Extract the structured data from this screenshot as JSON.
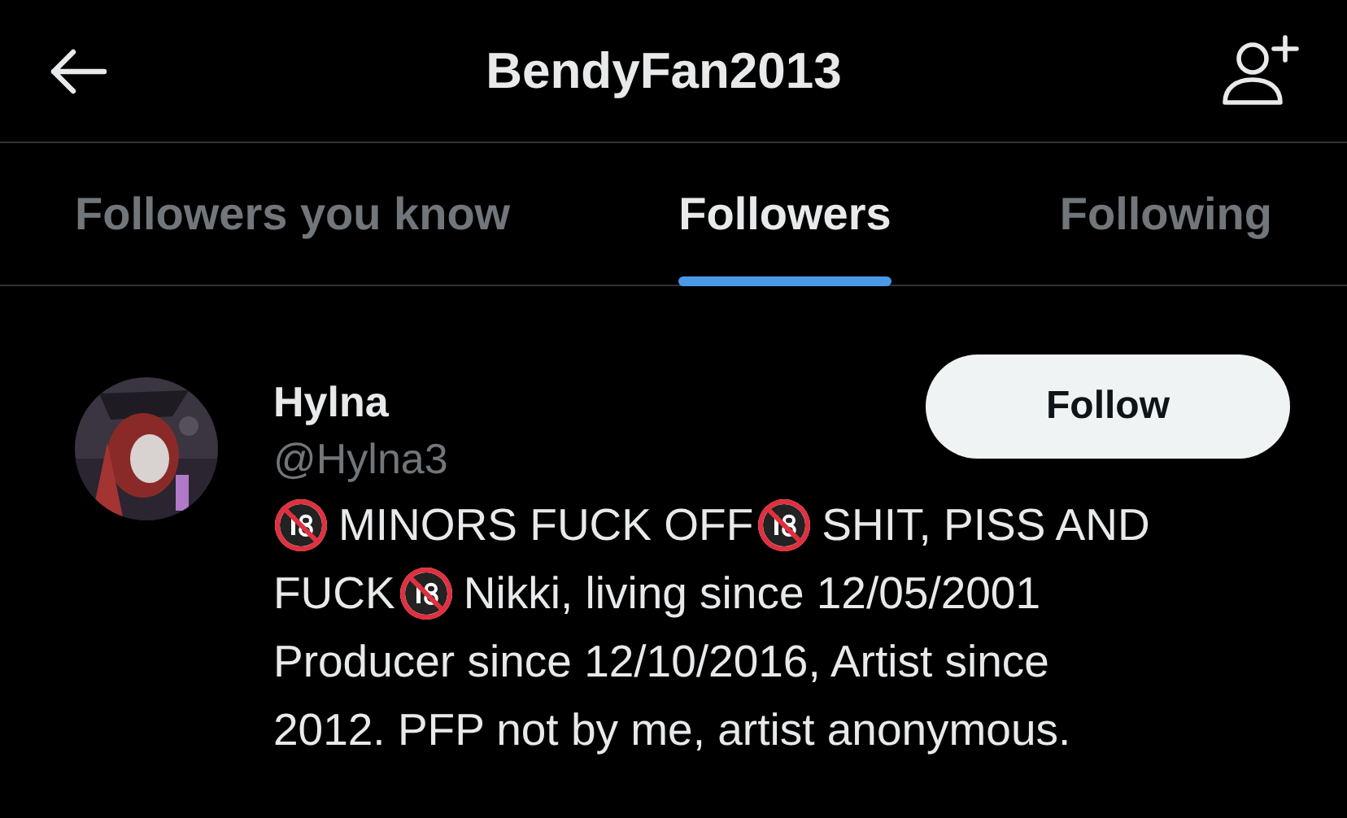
{
  "header": {
    "title": "BendyFan2013"
  },
  "tabs": [
    {
      "label": "Followers you know",
      "selected": false
    },
    {
      "label": "Followers",
      "selected": true
    },
    {
      "label": "Following",
      "selected": false
    }
  ],
  "users": [
    {
      "name": "Hylna",
      "handle": "@Hylna3",
      "button": "Follow",
      "avatar": {
        "kind": "picture"
      },
      "bio_lines": [
        [
          {
            "kind": "icon"
          },
          {
            "kind": "text",
            "text": "MINORS FUCK OFF"
          },
          {
            "kind": "icon"
          },
          {
            "kind": "text",
            "text": "SHIT, PISS AND"
          }
        ],
        [
          {
            "kind": "text",
            "text": "FUCK"
          },
          {
            "kind": "icon"
          },
          {
            "kind": "text",
            "text": "Nikki, living since 12/05/2001"
          }
        ],
        [
          {
            "kind": "text",
            "text": "Producer since 12/10/2016, Artist since"
          }
        ],
        [
          {
            "kind": "text",
            "text": "2012. PFP not by me, artist anonymous."
          }
        ]
      ]
    }
  ]
}
